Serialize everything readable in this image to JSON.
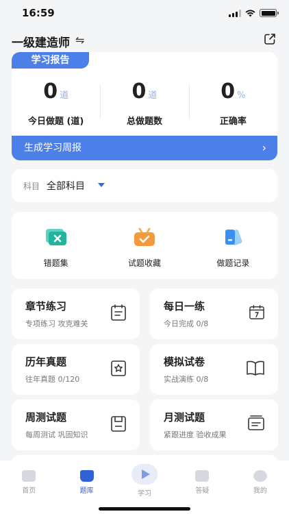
{
  "status_bar": {
    "time": "16:59"
  },
  "header": {
    "title": "一级建造师",
    "switch_icon": "⇋"
  },
  "report": {
    "tab_label": "学习报告",
    "stats": [
      {
        "value": "0",
        "unit": "道",
        "label": "今日做题 (道)"
      },
      {
        "value": "0",
        "unit": "道",
        "label": "总做题数"
      },
      {
        "value": "0",
        "unit": "%",
        "label": "正确率"
      }
    ],
    "weekly_button": "生成学习周报",
    "weekly_arrow": "›"
  },
  "subject": {
    "label": "科目",
    "value": "全部科目"
  },
  "tools": [
    {
      "label": "错题集",
      "icon": "wrong-book-icon"
    },
    {
      "label": "试题收藏",
      "icon": "favorites-icon"
    },
    {
      "label": "做题记录",
      "icon": "records-icon"
    }
  ],
  "practice": [
    {
      "title": "章节练习",
      "subtitle": "专项练习 攻克难关",
      "icon": "notes-icon"
    },
    {
      "title": "每日一练",
      "subtitle": "今日完成 0/8",
      "icon": "calendar-icon"
    },
    {
      "title": "历年真题",
      "subtitle": "往年真题 0/120",
      "icon": "star-doc-icon"
    },
    {
      "title": "模拟试卷",
      "subtitle": "实战演练 0/8",
      "icon": "book-icon"
    },
    {
      "title": "周测试题",
      "subtitle": "每周测试 巩固知识",
      "icon": "save-doc-icon"
    },
    {
      "title": "月测试题",
      "subtitle": "紧跟进度 验收成果",
      "icon": "card-icon"
    }
  ],
  "tabbar": [
    {
      "label": "首页",
      "icon": "home-icon"
    },
    {
      "label": "题库",
      "icon": "question-bank-icon",
      "active": true
    },
    {
      "label": "学习",
      "icon": "play-icon"
    },
    {
      "label": "答疑",
      "icon": "qa-icon"
    },
    {
      "label": "我的",
      "icon": "profile-icon"
    }
  ],
  "colors": {
    "accent": "#4d7fe9",
    "active_tab": "#2f62d8",
    "background": "#f4f5f7"
  }
}
